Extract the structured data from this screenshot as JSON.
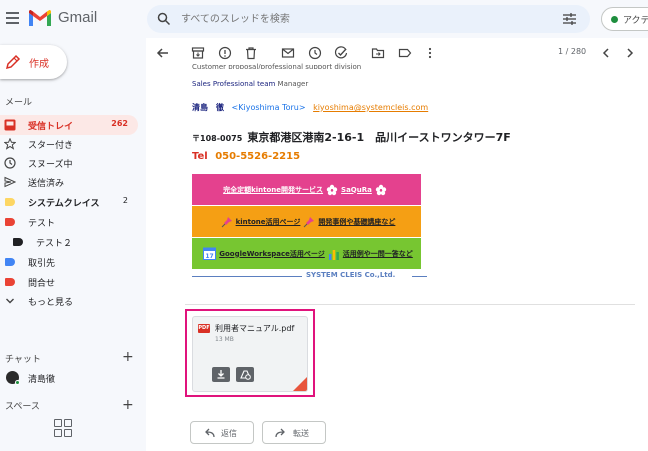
{
  "app": {
    "name": "Gmail",
    "brand_colors": {
      "red": "#ea4335",
      "blue": "#4285f4",
      "green": "#34a853",
      "yellow": "#fbbc04"
    }
  },
  "search": {
    "placeholder": "すべてのスレッドを検索"
  },
  "status": {
    "label": "アクティブ"
  },
  "compose": {
    "label": "作成"
  },
  "sidebar": {
    "mail_heading": "メール",
    "items": [
      {
        "label": "受信トレイ",
        "count": "262",
        "icon": "inbox-icon",
        "active": true
      },
      {
        "label": "スター付き",
        "count": "",
        "icon": "star-icon"
      },
      {
        "label": "スヌーズ中",
        "count": "",
        "icon": "clock-icon"
      },
      {
        "label": "送信済み",
        "count": "",
        "icon": "send-icon"
      },
      {
        "label": "システムクレイス",
        "count": "2",
        "icon": "label-icon",
        "color": "#fdd663"
      },
      {
        "label": "テスト",
        "count": "",
        "icon": "label-icon",
        "color": "#ea4335"
      },
      {
        "label": "テスト２",
        "count": "",
        "icon": "label-icon",
        "color": "#202124"
      },
      {
        "label": "取引先",
        "count": "",
        "icon": "label-icon",
        "color": "#4285f4"
      },
      {
        "label": "問合せ",
        "count": "",
        "icon": "label-icon",
        "color": "#ea4335"
      },
      {
        "label": "もっと見る",
        "count": "",
        "icon": "chevron-down-icon"
      }
    ],
    "chat_heading": "チャット",
    "contact": "清島徹",
    "spaces_heading": "スペース"
  },
  "toolbar": {
    "pager": "1 / 280"
  },
  "message": {
    "signature_dept": "Customer proposal/professional support division",
    "team": "Sales Professional team",
    "team_role": "Manager",
    "name_jp": "清島　徹",
    "name_en": "<Kiyoshima Toru>",
    "email": "kiyoshima@systemcleis.com",
    "zip": "〒108-0075",
    "address": "東京都港区港南2-16-1　品川イーストワンタワー7F",
    "tel_label": "Tel",
    "tel": "050-5526-2215",
    "banner1": "完全定額kintone開発サービス",
    "banner1_brand": "SaQuRa",
    "banner2a": "kintone活用ページ",
    "banner2b": "開発事例や基礎講座など",
    "banner3a": "GoogleWorkspace活用ページ",
    "banner3b": "活用例や一問一答など",
    "company": "SYSTEM CLEIS Co.,Ltd."
  },
  "attachment": {
    "type_badge": "PDF",
    "name": "利用者マニュアル.pdf",
    "size": "13 MB"
  },
  "actions": {
    "reply": "返信",
    "forward": "転送"
  }
}
